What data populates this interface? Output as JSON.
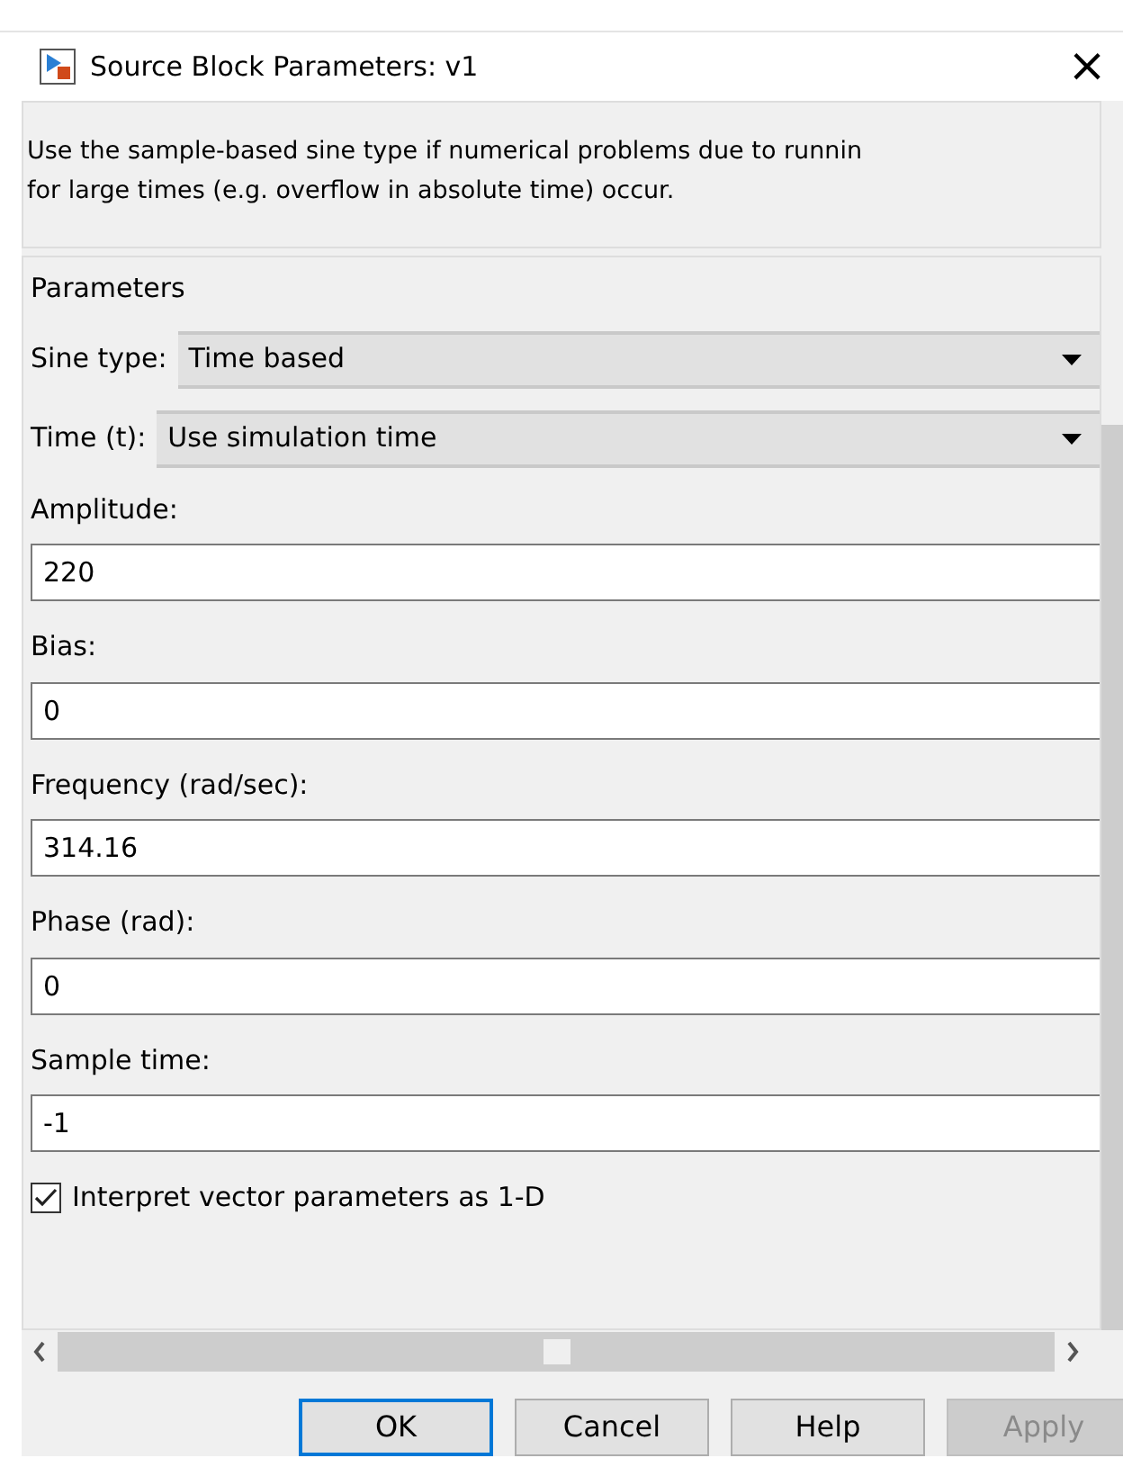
{
  "window": {
    "title": "Source Block Parameters: v1",
    "close": "×"
  },
  "description": [
    "Use the sample-based sine type if numerical problems due to runnin",
    "for large times (e.g. overflow in absolute time) occur."
  ],
  "group": {
    "label": "Parameters"
  },
  "parameters": [
    {
      "kind": "dropdown",
      "label": "Sine type:",
      "value": "Time based"
    },
    {
      "kind": "dropdown",
      "label": "Time (t):",
      "value": "Use simulation time"
    },
    {
      "kind": "text",
      "label": "Amplitude:",
      "value": "220"
    },
    {
      "kind": "text",
      "label": "Bias:",
      "value": "0"
    },
    {
      "kind": "text",
      "label": "Frequency (rad/sec):",
      "value": "314.16"
    },
    {
      "kind": "text",
      "label": "Phase (rad):",
      "value": "0"
    },
    {
      "kind": "text",
      "label": "Sample time:",
      "value": "-1"
    }
  ],
  "checkbox": {
    "label": "Interpret vector parameters as 1-D",
    "checked": true
  },
  "buttons": [
    {
      "label": "OK",
      "selected": true,
      "disabled": false
    },
    {
      "label": "Cancel",
      "selected": false,
      "disabled": false
    },
    {
      "label": "Help",
      "selected": false,
      "disabled": false
    },
    {
      "label": "Apply",
      "selected": false,
      "disabled": true
    }
  ]
}
